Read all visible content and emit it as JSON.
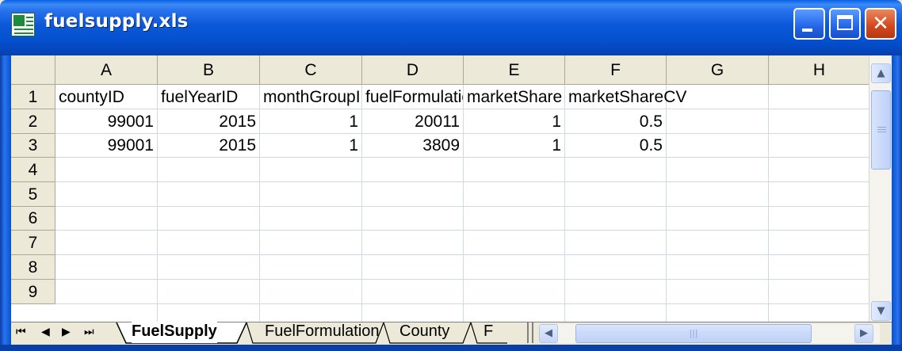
{
  "window": {
    "title": "fuelsupply.xls"
  },
  "columns": [
    "A",
    "B",
    "C",
    "D",
    "E",
    "F",
    "G",
    "H"
  ],
  "rows": [
    "1",
    "2",
    "3",
    "4",
    "5",
    "6",
    "7",
    "8",
    "9"
  ],
  "cells": {
    "r1": {
      "a": "countyID",
      "b": "fuelYearID",
      "c": "monthGroupID",
      "d": "fuelFormulationID",
      "e": "marketShare",
      "f": "marketShareCV"
    },
    "r2": {
      "a": "99001",
      "b": "2015",
      "c": "1",
      "d": "20011",
      "e": "1",
      "f": "0.5"
    },
    "r3": {
      "a": "99001",
      "b": "2015",
      "c": "1",
      "d": "3809",
      "e": "1",
      "f": "0.5"
    }
  },
  "tabs": [
    "FuelSupply",
    "FuelFormulation",
    "County",
    "F"
  ],
  "active_tab": "FuelSupply",
  "nav": {
    "first": "⏮",
    "prev": "◀",
    "next": "▶",
    "last": "⏭"
  },
  "colors": {
    "title_bar": "#0552D0",
    "close_button": "#D2471E",
    "chrome": "#ECE9D8"
  }
}
